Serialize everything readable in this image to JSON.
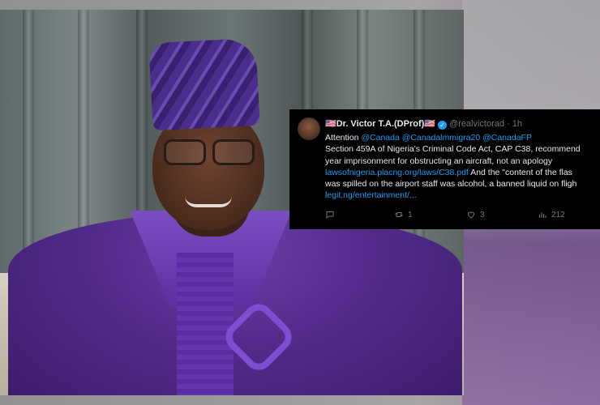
{
  "tweet": {
    "display_name": "🇺🇸Dr. Victor T.A.(DProf)🇺🇸",
    "handle": "@realvictorad",
    "time": "· 1h",
    "line1_prefix": "Attention ",
    "mentions": "@Canada @Canadalmmigra20 @CanadaFP",
    "line2": "Section 459A of Nigeria's Criminal Code Act, CAP C38, recommend",
    "line3": "year imprisonment for obstructing an aircraft, not an apology",
    "link1": "lawsofnigeria.placng.org/laws/C38.pdf",
    "line4_suffix": " And the \"content of the flas",
    "line5": "was spilled on the airport staff was alcohol, a banned liquid on fligh",
    "link2": "legit.ng/entertainment/...",
    "actions": {
      "reply_count": "",
      "retweet_count": "1",
      "like_count": "3",
      "views_count": "212"
    }
  },
  "colors": {
    "tweet_bg": "#000000",
    "link": "#1d9bf0",
    "muted": "#71767b",
    "robe": "#512a8a"
  }
}
